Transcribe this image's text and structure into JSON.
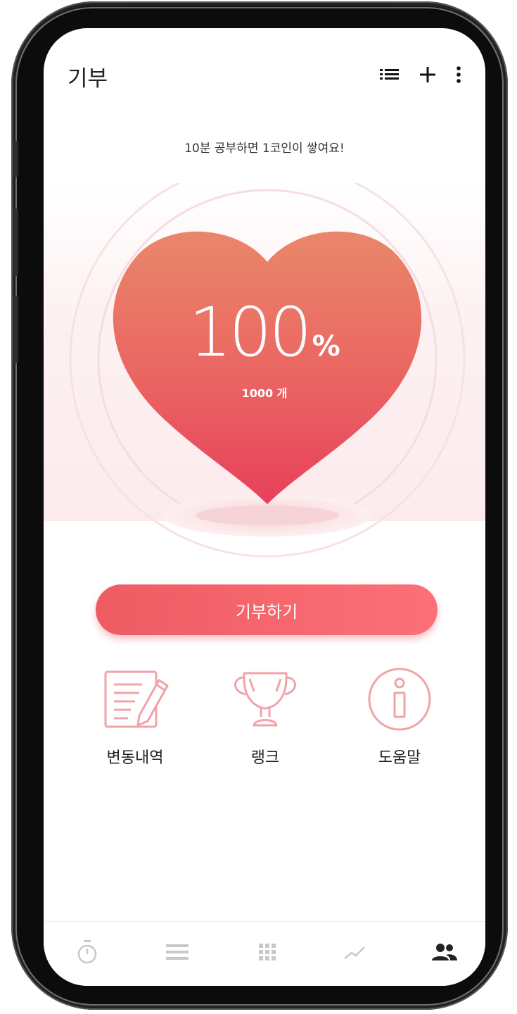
{
  "header": {
    "title": "기부",
    "icons": [
      "list-icon",
      "plus-icon",
      "more-vert-icon"
    ]
  },
  "notice": "10분 공부하면 1코인이 쌓여요!",
  "progress": {
    "percent_value": "100",
    "percent_sign": "%",
    "coin_count": "1000 개",
    "fill_fraction": 1.0
  },
  "donate_button": {
    "label": "기부하기"
  },
  "actions": [
    {
      "label": "변동내역",
      "icon": "history-document-icon"
    },
    {
      "label": "랭크",
      "icon": "trophy-icon"
    },
    {
      "label": "도움말",
      "icon": "info-icon"
    }
  ],
  "bottom_nav": [
    {
      "icon": "stopwatch-icon",
      "active": false
    },
    {
      "icon": "list-icon",
      "active": false
    },
    {
      "icon": "grid-icon",
      "active": false
    },
    {
      "icon": "trend-chart-icon",
      "active": false
    },
    {
      "icon": "people-icon",
      "active": true
    }
  ],
  "colors": {
    "accent": "#ef5f68",
    "heart_top": "#e9876a",
    "heart_bottom": "#e8405a",
    "icon_outline": "#f0a3a8",
    "nav_inactive": "#c8c8c8",
    "nav_active": "#222222"
  }
}
